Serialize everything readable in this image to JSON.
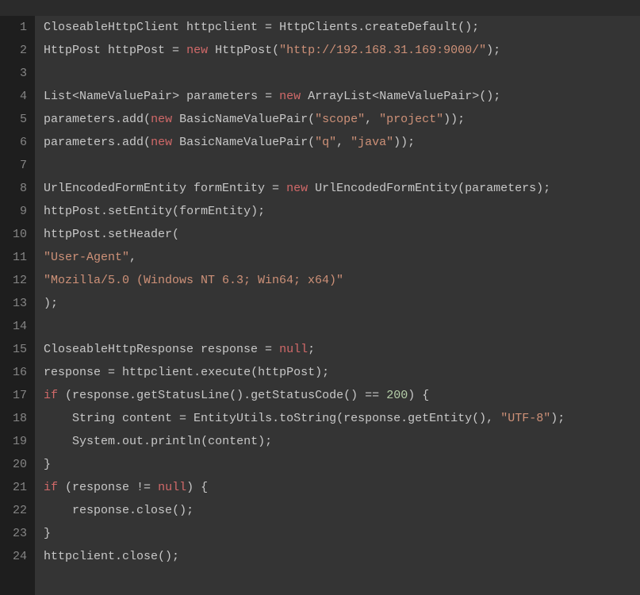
{
  "editor": {
    "gutter": [
      "1",
      "2",
      "3",
      "4",
      "5",
      "6",
      "7",
      "8",
      "9",
      "10",
      "11",
      "12",
      "13",
      "14",
      "15",
      "16",
      "17",
      "18",
      "19",
      "20",
      "21",
      "22",
      "23",
      "24"
    ],
    "lines": [
      [
        {
          "t": "CloseableHttpClient httpclient ",
          "c": "tk-default"
        },
        {
          "t": "=",
          "c": "tk-punct"
        },
        {
          "t": " HttpClients",
          "c": "tk-default"
        },
        {
          "t": ".",
          "c": "tk-punct"
        },
        {
          "t": "createDefault",
          "c": "tk-method"
        },
        {
          "t": "();",
          "c": "tk-punct"
        }
      ],
      [
        {
          "t": "HttpPost httpPost ",
          "c": "tk-default"
        },
        {
          "t": "=",
          "c": "tk-punct"
        },
        {
          "t": " ",
          "c": "tk-default"
        },
        {
          "t": "new",
          "c": "tk-keyword"
        },
        {
          "t": " HttpPost",
          "c": "tk-default"
        },
        {
          "t": "(",
          "c": "tk-punct"
        },
        {
          "t": "\"http://192.168.31.169:9000/\"",
          "c": "tk-string"
        },
        {
          "t": ");",
          "c": "tk-punct"
        }
      ],
      [],
      [
        {
          "t": "List",
          "c": "tk-default"
        },
        {
          "t": "<",
          "c": "tk-punct"
        },
        {
          "t": "NameValuePair",
          "c": "tk-generic"
        },
        {
          "t": ">",
          "c": "tk-punct"
        },
        {
          "t": " parameters ",
          "c": "tk-default"
        },
        {
          "t": "=",
          "c": "tk-punct"
        },
        {
          "t": " ",
          "c": "tk-default"
        },
        {
          "t": "new",
          "c": "tk-keyword"
        },
        {
          "t": " ArrayList",
          "c": "tk-default"
        },
        {
          "t": "<",
          "c": "tk-punct"
        },
        {
          "t": "NameValuePair",
          "c": "tk-generic"
        },
        {
          "t": ">();",
          "c": "tk-punct"
        }
      ],
      [
        {
          "t": "parameters",
          "c": "tk-default"
        },
        {
          "t": ".",
          "c": "tk-punct"
        },
        {
          "t": "add",
          "c": "tk-method"
        },
        {
          "t": "(",
          "c": "tk-punct"
        },
        {
          "t": "new",
          "c": "tk-keyword"
        },
        {
          "t": " BasicNameValuePair",
          "c": "tk-default"
        },
        {
          "t": "(",
          "c": "tk-punct"
        },
        {
          "t": "\"scope\"",
          "c": "tk-string"
        },
        {
          "t": ", ",
          "c": "tk-punct"
        },
        {
          "t": "\"project\"",
          "c": "tk-string"
        },
        {
          "t": "));",
          "c": "tk-punct"
        }
      ],
      [
        {
          "t": "parameters",
          "c": "tk-default"
        },
        {
          "t": ".",
          "c": "tk-punct"
        },
        {
          "t": "add",
          "c": "tk-method"
        },
        {
          "t": "(",
          "c": "tk-punct"
        },
        {
          "t": "new",
          "c": "tk-keyword"
        },
        {
          "t": " BasicNameValuePair",
          "c": "tk-default"
        },
        {
          "t": "(",
          "c": "tk-punct"
        },
        {
          "t": "\"q\"",
          "c": "tk-string"
        },
        {
          "t": ", ",
          "c": "tk-punct"
        },
        {
          "t": "\"java\"",
          "c": "tk-string"
        },
        {
          "t": "));",
          "c": "tk-punct"
        }
      ],
      [],
      [
        {
          "t": "UrlEncodedFormEntity formEntity ",
          "c": "tk-default"
        },
        {
          "t": "=",
          "c": "tk-punct"
        },
        {
          "t": " ",
          "c": "tk-default"
        },
        {
          "t": "new",
          "c": "tk-keyword"
        },
        {
          "t": " UrlEncodedFormEntity",
          "c": "tk-default"
        },
        {
          "t": "(",
          "c": "tk-punct"
        },
        {
          "t": "parameters",
          "c": "tk-default"
        },
        {
          "t": ");",
          "c": "tk-punct"
        }
      ],
      [
        {
          "t": "httpPost",
          "c": "tk-default"
        },
        {
          "t": ".",
          "c": "tk-punct"
        },
        {
          "t": "setEntity",
          "c": "tk-method"
        },
        {
          "t": "(",
          "c": "tk-punct"
        },
        {
          "t": "formEntity",
          "c": "tk-default"
        },
        {
          "t": ");",
          "c": "tk-punct"
        }
      ],
      [
        {
          "t": "httpPost",
          "c": "tk-default"
        },
        {
          "t": ".",
          "c": "tk-punct"
        },
        {
          "t": "setHeader",
          "c": "tk-method"
        },
        {
          "t": "(",
          "c": "tk-punct"
        }
      ],
      [
        {
          "t": "\"User-Agent\"",
          "c": "tk-string"
        },
        {
          "t": ",",
          "c": "tk-punct"
        }
      ],
      [
        {
          "t": "\"Mozilla/5.0 (Windows NT 6.3; Win64; x64)\"",
          "c": "tk-string"
        }
      ],
      [
        {
          "t": ");",
          "c": "tk-punct"
        }
      ],
      [],
      [
        {
          "t": "CloseableHttpResponse response ",
          "c": "tk-default"
        },
        {
          "t": "=",
          "c": "tk-punct"
        },
        {
          "t": " ",
          "c": "tk-default"
        },
        {
          "t": "null",
          "c": "tk-null"
        },
        {
          "t": ";",
          "c": "tk-punct"
        }
      ],
      [
        {
          "t": "response ",
          "c": "tk-default"
        },
        {
          "t": "=",
          "c": "tk-punct"
        },
        {
          "t": " httpclient",
          "c": "tk-default"
        },
        {
          "t": ".",
          "c": "tk-punct"
        },
        {
          "t": "execute",
          "c": "tk-method"
        },
        {
          "t": "(",
          "c": "tk-punct"
        },
        {
          "t": "httpPost",
          "c": "tk-default"
        },
        {
          "t": ");",
          "c": "tk-punct"
        }
      ],
      [
        {
          "t": "if",
          "c": "tk-keyword"
        },
        {
          "t": " (",
          "c": "tk-punct"
        },
        {
          "t": "response",
          "c": "tk-default"
        },
        {
          "t": ".",
          "c": "tk-punct"
        },
        {
          "t": "getStatusLine",
          "c": "tk-method"
        },
        {
          "t": "().",
          "c": "tk-punct"
        },
        {
          "t": "getStatusCode",
          "c": "tk-method"
        },
        {
          "t": "() ",
          "c": "tk-punct"
        },
        {
          "t": "==",
          "c": "tk-punct"
        },
        {
          "t": " ",
          "c": "tk-default"
        },
        {
          "t": "200",
          "c": "tk-number"
        },
        {
          "t": ") {",
          "c": "tk-punct"
        }
      ],
      [
        {
          "t": "    String content ",
          "c": "tk-default"
        },
        {
          "t": "=",
          "c": "tk-punct"
        },
        {
          "t": " EntityUtils",
          "c": "tk-default"
        },
        {
          "t": ".",
          "c": "tk-punct"
        },
        {
          "t": "toString",
          "c": "tk-method"
        },
        {
          "t": "(",
          "c": "tk-punct"
        },
        {
          "t": "response",
          "c": "tk-default"
        },
        {
          "t": ".",
          "c": "tk-punct"
        },
        {
          "t": "getEntity",
          "c": "tk-method"
        },
        {
          "t": "(), ",
          "c": "tk-punct"
        },
        {
          "t": "\"UTF-8\"",
          "c": "tk-string"
        },
        {
          "t": ");",
          "c": "tk-punct"
        }
      ],
      [
        {
          "t": "    System",
          "c": "tk-default"
        },
        {
          "t": ".",
          "c": "tk-punct"
        },
        {
          "t": "out",
          "c": "tk-default"
        },
        {
          "t": ".",
          "c": "tk-punct"
        },
        {
          "t": "println",
          "c": "tk-method"
        },
        {
          "t": "(",
          "c": "tk-punct"
        },
        {
          "t": "content",
          "c": "tk-default"
        },
        {
          "t": ");",
          "c": "tk-punct"
        }
      ],
      [
        {
          "t": "}",
          "c": "tk-punct"
        }
      ],
      [
        {
          "t": "if",
          "c": "tk-keyword"
        },
        {
          "t": " (",
          "c": "tk-punct"
        },
        {
          "t": "response ",
          "c": "tk-default"
        },
        {
          "t": "!=",
          "c": "tk-punct"
        },
        {
          "t": " ",
          "c": "tk-default"
        },
        {
          "t": "null",
          "c": "tk-null"
        },
        {
          "t": ") {",
          "c": "tk-punct"
        }
      ],
      [
        {
          "t": "    response",
          "c": "tk-default"
        },
        {
          "t": ".",
          "c": "tk-punct"
        },
        {
          "t": "close",
          "c": "tk-method"
        },
        {
          "t": "();",
          "c": "tk-punct"
        }
      ],
      [
        {
          "t": "}",
          "c": "tk-punct"
        }
      ],
      [
        {
          "t": "httpclient",
          "c": "tk-default"
        },
        {
          "t": ".",
          "c": "tk-punct"
        },
        {
          "t": "close",
          "c": "tk-method"
        },
        {
          "t": "();",
          "c": "tk-punct"
        }
      ]
    ]
  }
}
